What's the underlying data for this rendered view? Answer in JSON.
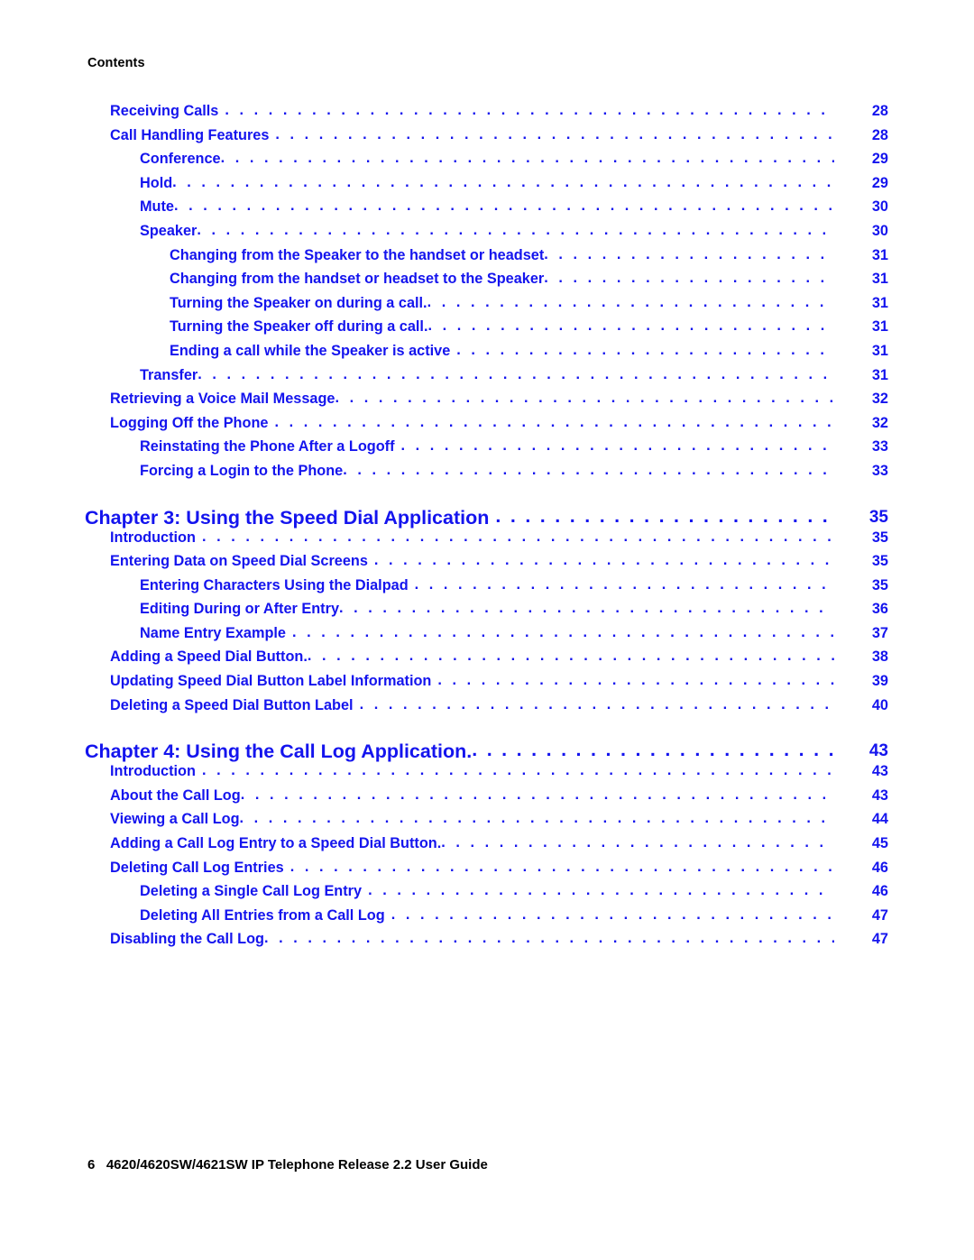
{
  "page": {
    "running_header": "Contents",
    "footer": "6   4620/4620SW/4621SW IP Telephone Release 2.2 User Guide",
    "accent_color": "#1414ee",
    "text_color": "#000000",
    "background_color": "#ffffff",
    "leader_char": "."
  },
  "toc": {
    "entries": [
      {
        "label": "Receiving Calls",
        "page": "28",
        "level": 1,
        "gap": true
      },
      {
        "label": "Call Handling Features",
        "page": "28",
        "level": 1,
        "gap": true
      },
      {
        "label": "Conference",
        "page": "29",
        "level": 2,
        "gap": false
      },
      {
        "label": "Hold",
        "page": "29",
        "level": 2,
        "gap": false
      },
      {
        "label": "Mute",
        "page": "30",
        "level": 2,
        "gap": false
      },
      {
        "label": "Speaker",
        "page": "30",
        "level": 2,
        "gap": false
      },
      {
        "label": "Changing from the Speaker to the handset or headset",
        "page": "31",
        "level": 3,
        "gap": false
      },
      {
        "label": "Changing from the handset or headset to the Speaker",
        "page": "31",
        "level": 3,
        "gap": false
      },
      {
        "label": "Turning the Speaker on during a call.",
        "page": "31",
        "level": 3,
        "gap": false
      },
      {
        "label": "Turning the Speaker off during a call.",
        "page": "31",
        "level": 3,
        "gap": false
      },
      {
        "label": "Ending a call while the Speaker is active",
        "page": "31",
        "level": 3,
        "gap": true
      },
      {
        "label": "Transfer",
        "page": "31",
        "level": 2,
        "gap": false
      },
      {
        "label": "Retrieving a Voice Mail Message",
        "page": "32",
        "level": 1,
        "gap": false
      },
      {
        "label": "Logging Off the Phone",
        "page": "32",
        "level": 1,
        "gap": true
      },
      {
        "label": "Reinstating the Phone After a Logoff",
        "page": "33",
        "level": 2,
        "gap": true
      },
      {
        "label": "Forcing a Login to the Phone",
        "page": "33",
        "level": 2,
        "gap": false
      },
      {
        "label": "Chapter 3: Using the Speed Dial Application",
        "page": "35",
        "level": 0,
        "gap": true
      },
      {
        "label": "Introduction",
        "page": "35",
        "level": 1,
        "gap": true
      },
      {
        "label": "Entering Data on Speed Dial Screens",
        "page": "35",
        "level": 1,
        "gap": true
      },
      {
        "label": "Entering Characters Using the Dialpad",
        "page": "35",
        "level": 2,
        "gap": true
      },
      {
        "label": "Editing During or After Entry",
        "page": "36",
        "level": 2,
        "gap": false
      },
      {
        "label": "Name Entry Example",
        "page": "37",
        "level": 2,
        "gap": true
      },
      {
        "label": "Adding a Speed Dial Button.",
        "page": "38",
        "level": 1,
        "gap": false
      },
      {
        "label": "Updating Speed Dial Button Label Information",
        "page": "39",
        "level": 1,
        "gap": true
      },
      {
        "label": "Deleting a Speed Dial Button Label",
        "page": "40",
        "level": 1,
        "gap": true
      },
      {
        "label": "Chapter 4: Using the Call Log Application.",
        "page": "43",
        "level": 0,
        "gap": false
      },
      {
        "label": "Introduction",
        "page": "43",
        "level": 1,
        "gap": true
      },
      {
        "label": "About the Call Log",
        "page": "43",
        "level": 1,
        "gap": false
      },
      {
        "label": "Viewing a Call Log",
        "page": "44",
        "level": 1,
        "gap": false
      },
      {
        "label": "Adding a Call Log Entry to a Speed Dial Button.",
        "page": "45",
        "level": 1,
        "gap": false
      },
      {
        "label": "Deleting Call Log Entries",
        "page": "46",
        "level": 1,
        "gap": true
      },
      {
        "label": "Deleting a Single Call Log Entry",
        "page": "46",
        "level": 2,
        "gap": true
      },
      {
        "label": "Deleting All Entries from a Call Log",
        "page": "47",
        "level": 2,
        "gap": true
      },
      {
        "label": "Disabling the Call Log",
        "page": "47",
        "level": 1,
        "gap": false
      }
    ]
  }
}
